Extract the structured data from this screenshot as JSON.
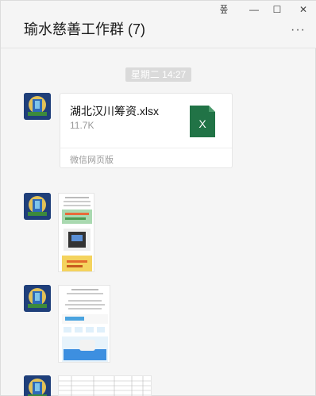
{
  "window": {
    "title": "瑜水慈善工作群 (7)",
    "controls": {
      "pin": "퐆",
      "minimize": "—",
      "maximize": "☐",
      "close": "✕"
    },
    "more": "···"
  },
  "chat": {
    "timestamp": "星期二 14:27",
    "file": {
      "name": "湖北汉川筹资.xlsx",
      "size": "11.7K",
      "source": "微信网页版",
      "icon_letter": "X",
      "icon_color": "#217346"
    }
  }
}
